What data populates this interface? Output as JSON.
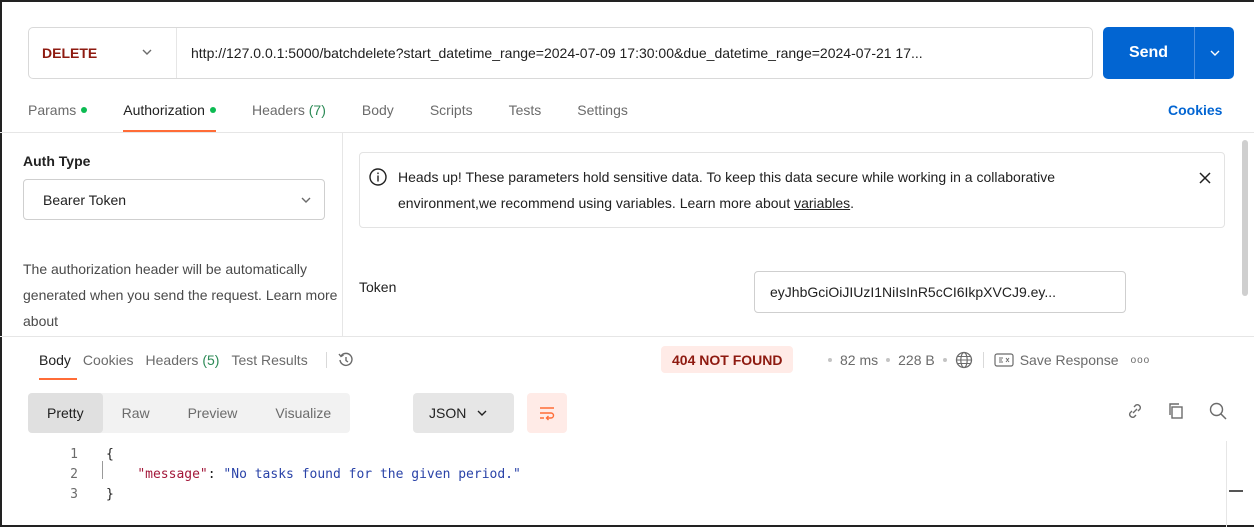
{
  "request": {
    "method": "DELETE",
    "url": "http://127.0.0.1:5000/batchdelete?start_datetime_range=2024-07-09 17:30:00&due_datetime_range=2024-07-21 17...",
    "send_label": "Send"
  },
  "request_tabs": [
    {
      "label": "Params",
      "has_dot": true
    },
    {
      "label": "Authorization",
      "has_dot": true
    },
    {
      "label": "Headers",
      "count": "(7)"
    },
    {
      "label": "Body"
    },
    {
      "label": "Scripts"
    },
    {
      "label": "Tests"
    },
    {
      "label": "Settings"
    }
  ],
  "cookies_link": "Cookies",
  "auth": {
    "type_label": "Auth Type",
    "type_value": "Bearer Token",
    "description": "The authorization header will be automatically generated when you send the request. Learn more about",
    "notice_text": "Heads up! These parameters hold sensitive data. To keep this data secure while working in a collaborative environment,we recommend using variables. Learn more about ",
    "notice_link": "variables",
    "notice_end": ".",
    "token_label": "Token",
    "token_value": "eyJhbGciOiJIUzI1NiIsInR5cCI6IkpXVCJ9.ey..."
  },
  "response_tabs": [
    {
      "label": "Body"
    },
    {
      "label": "Cookies"
    },
    {
      "label": "Headers",
      "count": "(5)"
    },
    {
      "label": "Test Results"
    }
  ],
  "response_meta": {
    "status": "404 NOT FOUND",
    "time": "82 ms",
    "size": "228 B",
    "save_label": "Save Response",
    "more": "ooo"
  },
  "view_modes": [
    "Pretty",
    "Raw",
    "Preview",
    "Visualize"
  ],
  "format": "JSON",
  "code_lines": [
    {
      "num": "1",
      "text": "{"
    },
    {
      "num": "2",
      "key": "\"message\"",
      "colon": ": ",
      "value": "\"No tasks found for the given period.\""
    },
    {
      "num": "3",
      "text": "}"
    }
  ],
  "colors": {
    "accent": "#ff6c37",
    "send": "#0265d2",
    "method": "#8e1a10",
    "status_bg": "#ffebe7",
    "dot": "#0cbb52"
  }
}
